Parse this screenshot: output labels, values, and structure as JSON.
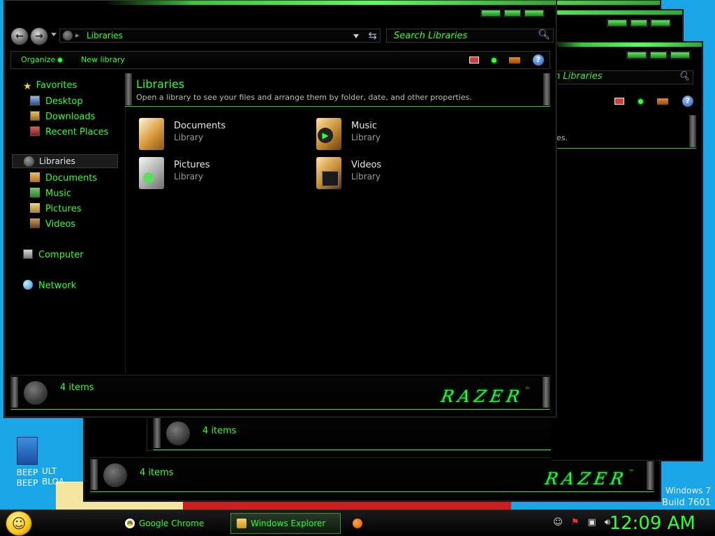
{
  "window": {
    "address": "Libraries",
    "search_placeholder": "Search Libraries"
  },
  "toolbar": {
    "organize": "Organize",
    "new_library": "New library",
    "help": "?"
  },
  "nav": {
    "favorites": "Favorites",
    "desktop": "Desktop",
    "downloads": "Downloads",
    "recent_places": "Recent Places",
    "libraries": "Libraries",
    "documents": "Documents",
    "music": "Music",
    "pictures": "Pictures",
    "videos": "Videos",
    "computer": "Computer",
    "network": "Network"
  },
  "content": {
    "title": "Libraries",
    "subtitle": "Open a library to see your files and arrange them by folder, date, and other properties.",
    "libraries": [
      {
        "name": "Documents",
        "kind": "Library"
      },
      {
        "name": "Music",
        "kind": "Library"
      },
      {
        "name": "Pictures",
        "kind": "Library"
      },
      {
        "name": "Videos",
        "kind": "Library"
      }
    ]
  },
  "status": {
    "items": "4 items",
    "logo": "RAZER",
    "logo_tm": "™"
  },
  "bg_windows": {
    "search_partial": "h Libraries",
    "subtitle_partial": "ies.",
    "items": "4 items"
  },
  "desktop": {
    "icon1_line1": "BEEP",
    "icon1_line2": "BEEP",
    "icon2_line1": "ULT",
    "icon2_line2": "BLOA",
    "os_line1": "Windows 7",
    "os_line2": "Build 7601"
  },
  "taskbar": {
    "chrome": "Google Chrome",
    "explorer": "Windows Explorer",
    "clock": "12:09 AM"
  },
  "colors": {
    "accent": "#33ff33",
    "desktop": "#1aa6e6",
    "window": "#000000"
  }
}
